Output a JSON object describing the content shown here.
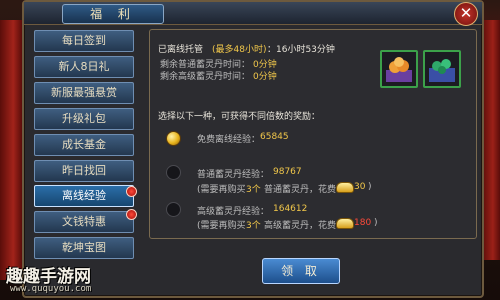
{
  "window": {
    "title": "福 利"
  },
  "sidebar": {
    "items": [
      {
        "label": "每日签到"
      },
      {
        "label": "新人8日礼"
      },
      {
        "label": "新服最强悬赏"
      },
      {
        "label": "升级礼包"
      },
      {
        "label": "成长基金"
      },
      {
        "label": "昨日找回"
      },
      {
        "label": "离线经验",
        "active": true
      },
      {
        "label": "文钱特惠"
      },
      {
        "label": "乾坤宝图"
      }
    ]
  },
  "offline": {
    "hosted_label": "已离线托管",
    "hosted_max": "(最多48小时)",
    "hosted_value": "：16小时53分钟",
    "remain_normal_label": "剩余普通蓄灵丹时间：",
    "remain_normal_value": "0分钟",
    "remain_advanced_label": "剩余高级蓄灵丹时间：",
    "remain_advanced_value": "0分钟"
  },
  "choose_prompt": "选择以下一种，可获得不同倍数的奖励：",
  "options": {
    "free_label": "免费离线经验：",
    "free_value": "65845",
    "normal_label": "普通蓄灵丹经验：",
    "normal_value": "98767",
    "normal_note_a": "(需要再购买",
    "normal_note_b": "3个",
    "normal_note_c": "普通蓄灵丹，花费",
    "normal_cost": "30",
    "normal_close": ")",
    "advanced_label": "高级蓄灵丹经验：",
    "advanced_value": "164612",
    "advanced_note_a": "(需要再购买",
    "advanced_note_b": "3个",
    "advanced_note_c": "高级蓄灵丹，花费",
    "advanced_cost": "180",
    "advanced_close": ")"
  },
  "claim_button": "领 取",
  "watermark": {
    "text": "趣趣手游网",
    "url": "www.ququyou.com"
  },
  "icons": [
    "close-icon",
    "peach-item-icon",
    "jade-item-icon",
    "gold-coin-icon",
    "gold-ingot-icon"
  ],
  "colors": {
    "accent_yellow": "#f1c74a",
    "highlight_red": "#ff4a3a",
    "item_border_green": "#3ca14a"
  }
}
